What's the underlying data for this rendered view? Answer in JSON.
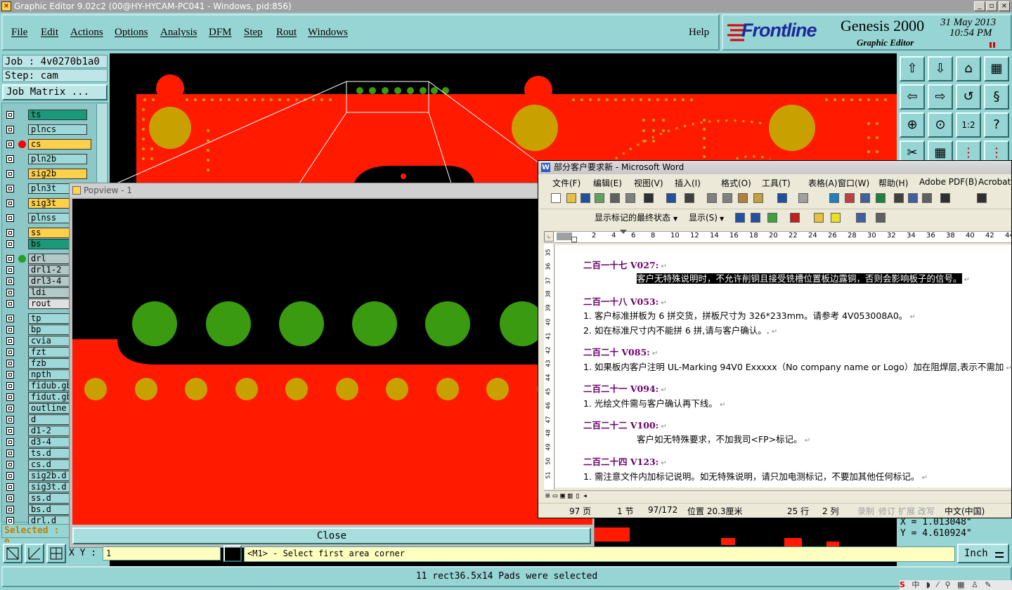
{
  "window": {
    "title": "Graphic Editor 9.02c2 (00@HY-HYCAM-PC041 - Windows, pid:856)"
  },
  "menubar": {
    "items": [
      "File",
      "Edit",
      "Actions",
      "Options",
      "Analysis",
      "DFM",
      "Step",
      "Rout",
      "Windows"
    ],
    "help": "Help"
  },
  "brand": {
    "logo": "Frontline",
    "product": "Genesis 2000",
    "subtitle": "Graphic Editor",
    "date": "31 May 2013",
    "time": "10:54 PM"
  },
  "job": {
    "job_label": "Job : 4v0270b1a0",
    "step_label": "Step: cam",
    "matrix_button": "Job Matrix ..."
  },
  "layers": [
    {
      "name": "ts",
      "color": "#1a9a7a",
      "dot": ""
    },
    {
      "name": "plncs",
      "color": "#9ed8d8",
      "dot": ""
    },
    {
      "name": "cs",
      "color": "#ffd04a",
      "dot": "#ff0000"
    },
    {
      "name": "pln2b",
      "color": "#9ed8d8",
      "dot": ""
    },
    {
      "name": "sig2b",
      "color": "#ffd04a",
      "dot": ""
    },
    {
      "name": "pln3t",
      "color": "#9ed8d8",
      "dot": ""
    },
    {
      "name": "sig3t",
      "color": "#ffd04a",
      "dot": ""
    },
    {
      "name": "plnss",
      "color": "#9ed8d8",
      "dot": ""
    },
    {
      "name": "ss",
      "color": "#ffd04a",
      "dot": ""
    },
    {
      "name": "bs",
      "color": "#1a9a7a",
      "dot": ""
    },
    {
      "name": "drl",
      "color": "#b4c8c8",
      "dot": "#22a022"
    },
    {
      "name": "drl1-2",
      "color": "#b4c8c8",
      "dot": ""
    },
    {
      "name": "drl3-4",
      "color": "#b4c8c8",
      "dot": ""
    },
    {
      "name": "ldi",
      "color": "#b4c8c8",
      "dot": ""
    },
    {
      "name": "rout",
      "color": "#e0e0e0",
      "dot": ""
    },
    {
      "name": "tp",
      "color": "#9ed8d8",
      "dot": ""
    },
    {
      "name": "bp",
      "color": "#9ed8d8",
      "dot": ""
    },
    {
      "name": "cvia",
      "color": "#9ed8d8",
      "dot": ""
    },
    {
      "name": "fzt",
      "color": "#9ed8d8",
      "dot": ""
    },
    {
      "name": "fzb",
      "color": "#9ed8d8",
      "dot": ""
    },
    {
      "name": "npth",
      "color": "#9ed8d8",
      "dot": ""
    },
    {
      "name": "fidub.gb",
      "color": "#9ed8d8",
      "dot": ""
    },
    {
      "name": "fidut.gb",
      "color": "#9ed8d8",
      "dot": ""
    },
    {
      "name": "outline",
      "color": "#9ed8d8",
      "dot": ""
    },
    {
      "name": "d",
      "color": "#9ed8d8",
      "dot": ""
    },
    {
      "name": "d1-2",
      "color": "#9ed8d8",
      "dot": ""
    },
    {
      "name": "d3-4",
      "color": "#9ed8d8",
      "dot": ""
    },
    {
      "name": "ts.d",
      "color": "#9ed8d8",
      "dot": ""
    },
    {
      "name": "cs.d",
      "color": "#9ed8d8",
      "dot": ""
    },
    {
      "name": "sig2b.d",
      "color": "#9ed8d8",
      "dot": ""
    },
    {
      "name": "sig3t.d",
      "color": "#9ed8d8",
      "dot": ""
    },
    {
      "name": "ss.d",
      "color": "#9ed8d8",
      "dot": ""
    },
    {
      "name": "bs.d",
      "color": "#9ed8d8",
      "dot": ""
    },
    {
      "name": "drl.d",
      "color": "#9ed8d8",
      "dot": ""
    }
  ],
  "selected": "Selected : 0",
  "popview": {
    "title": "Popview - 1",
    "close": "Close"
  },
  "coords": {
    "x": "X = 1.013048\"",
    "y": "Y = 4.610924\""
  },
  "bottombar": {
    "xy_label": "X Y :",
    "xy_value": "1",
    "prompt": "<M1> - Select first area corner",
    "units": "Inch"
  },
  "status": "11 rect36.5x14 Pads were selected",
  "word": {
    "title": "部分客户要求新 - Microsoft Word",
    "menus": [
      "文件(F)",
      "编辑(E)",
      "视图(V)",
      "插入(I)",
      "格式(O)",
      "工具(T)",
      "表格(A)",
      "窗口(W)",
      "帮助(H)",
      "Adobe PDF(B)",
      "Acrobat"
    ],
    "markup_dropdown": "显示标记的最终状态",
    "show_button": "显示(S)",
    "ruler_numbers": [
      "2",
      "4",
      "6",
      "8",
      "10",
      "12",
      "14",
      "16",
      "18",
      "20",
      "22",
      "24",
      "26",
      "28",
      "30",
      "32",
      "34",
      "36",
      "38",
      "40",
      "42",
      "44"
    ],
    "vruler_numbers": [
      "35",
      "36",
      "37",
      "38",
      "39",
      "40",
      "41",
      "42",
      "43",
      "44",
      "45",
      "46",
      "47",
      "48",
      "49",
      "50",
      "51"
    ],
    "paragraphs": [
      {
        "kind": "head",
        "text": "二百一十七 V027:"
      },
      {
        "kind": "hl",
        "text": "客户无特殊说明时，不允许削铜且接受铣槽位置板边露铜，否则会影响板子的信号。"
      },
      {
        "kind": "head",
        "text": "二百一十八 V053:"
      },
      {
        "kind": "body",
        "text": "1. 客户标准拼板为 6 拼交货，拼板尺寸为 326*233mm。请参考 4V053008A0。"
      },
      {
        "kind": "body",
        "text": "2. 如在标准尺寸内不能拼 6 拼,请与客户确认。."
      },
      {
        "kind": "head",
        "text": "二百二十 V085:"
      },
      {
        "kind": "body",
        "text": "1. 如果板内客户注明 UL-Marking 94V0 Exxxxx（No company name or Logo）加在阻焊层,表示不需加"
      },
      {
        "kind": "head",
        "text": "二百二十一 V094:"
      },
      {
        "kind": "body",
        "text": "1.  光绘文件需与客户确认再下线。"
      },
      {
        "kind": "head",
        "text": "二百二十二 V100:"
      },
      {
        "kind": "indent",
        "text": "客户如无特殊要求，不加我司<FP>标记。"
      },
      {
        "kind": "head",
        "text": "二百二十四 V123:"
      },
      {
        "kind": "body",
        "text": "1.  需注意文件内加标记说明。如无特殊说明，请只加电测标记，不要加其他任何标记。"
      }
    ],
    "statusbar": [
      "97 页",
      "1 节",
      "97/172",
      "位置 20.3厘米",
      "25 行",
      "2 列",
      "录制",
      "修订",
      "扩展",
      "改写",
      "中文(中国)"
    ]
  },
  "colors": {
    "app_bg": "#97d4d4",
    "pcb_copper": "#ff1a00",
    "pad_gold": "#c8a000",
    "pad_green": "#3a9a10",
    "canvas_bg": "#000000"
  }
}
